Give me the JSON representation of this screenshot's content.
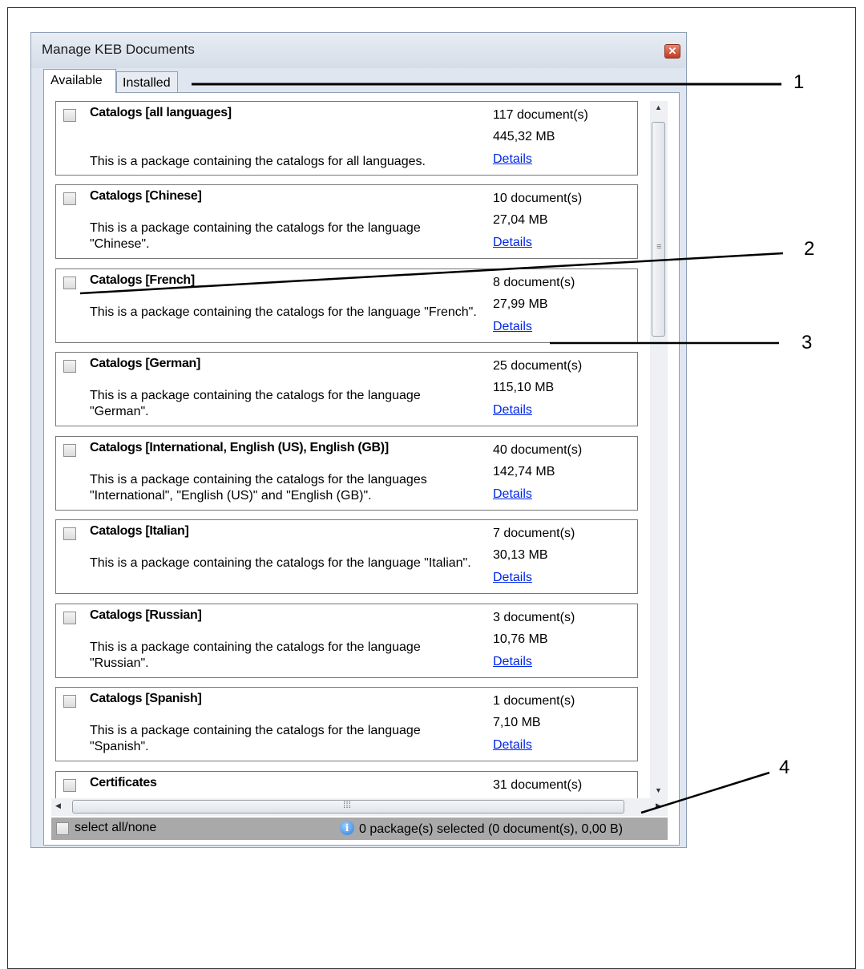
{
  "window": {
    "title": "Manage KEB Documents"
  },
  "tabs": [
    {
      "label": "Available"
    },
    {
      "label": "Installed"
    }
  ],
  "packages": [
    {
      "name": "Catalogs [all languages]",
      "desc": "This is a package containing the catalogs for all languages.",
      "count": "117 document(s)",
      "size": "445,32 MB",
      "details": "Details"
    },
    {
      "name": "Catalogs [Chinese]",
      "desc": "This is a package containing the catalogs for the language \"Chinese\".",
      "count": "10 document(s)",
      "size": "27,04 MB",
      "details": "Details"
    },
    {
      "name": "Catalogs [French]",
      "desc": "This is a package containing the catalogs for the language \"French\".",
      "count": "8 document(s)",
      "size": "27,99 MB",
      "details": "Details"
    },
    {
      "name": "Catalogs [German]",
      "desc": "This is a package containing the catalogs for the language \"German\".",
      "count": "25 document(s)",
      "size": "115,10 MB",
      "details": "Details"
    },
    {
      "name": "Catalogs [International, English (US), English (GB)]",
      "desc": "This is a package containing the catalogs for the languages \"International\", \"English (US)\" and \"English (GB)\".",
      "count": "40 document(s)",
      "size": "142,74 MB",
      "details": "Details"
    },
    {
      "name": "Catalogs [Italian]",
      "desc": "This is a package containing the catalogs for the language \"Italian\".",
      "count": "7 document(s)",
      "size": "30,13 MB",
      "details": "Details"
    },
    {
      "name": "Catalogs [Russian]",
      "desc": "This is a package containing the catalogs for the language \"Russian\".",
      "count": "3 document(s)",
      "size": "10,76 MB",
      "details": "Details"
    },
    {
      "name": "Catalogs [Spanish]",
      "desc": "This is a package containing the catalogs for the language \"Spanish\".",
      "count": "1 document(s)",
      "size": "7,10 MB",
      "details": "Details"
    },
    {
      "name": "Certificates",
      "desc": "",
      "count": "31 document(s)",
      "size": "",
      "details": ""
    }
  ],
  "status": {
    "select_all": "select all/none",
    "summary": "0 package(s) selected (0 document(s), 0,00 B)"
  },
  "callouts": [
    "1",
    "2",
    "3",
    "4"
  ],
  "colors": {
    "link": "#0026e6",
    "status_bar": "#a9a9a9",
    "window_bg": "#dfe6ef"
  },
  "icons": [
    "close-icon",
    "info-icon",
    "scroll-up-icon",
    "scroll-down-icon",
    "scroll-left-icon",
    "scroll-right-icon"
  ]
}
